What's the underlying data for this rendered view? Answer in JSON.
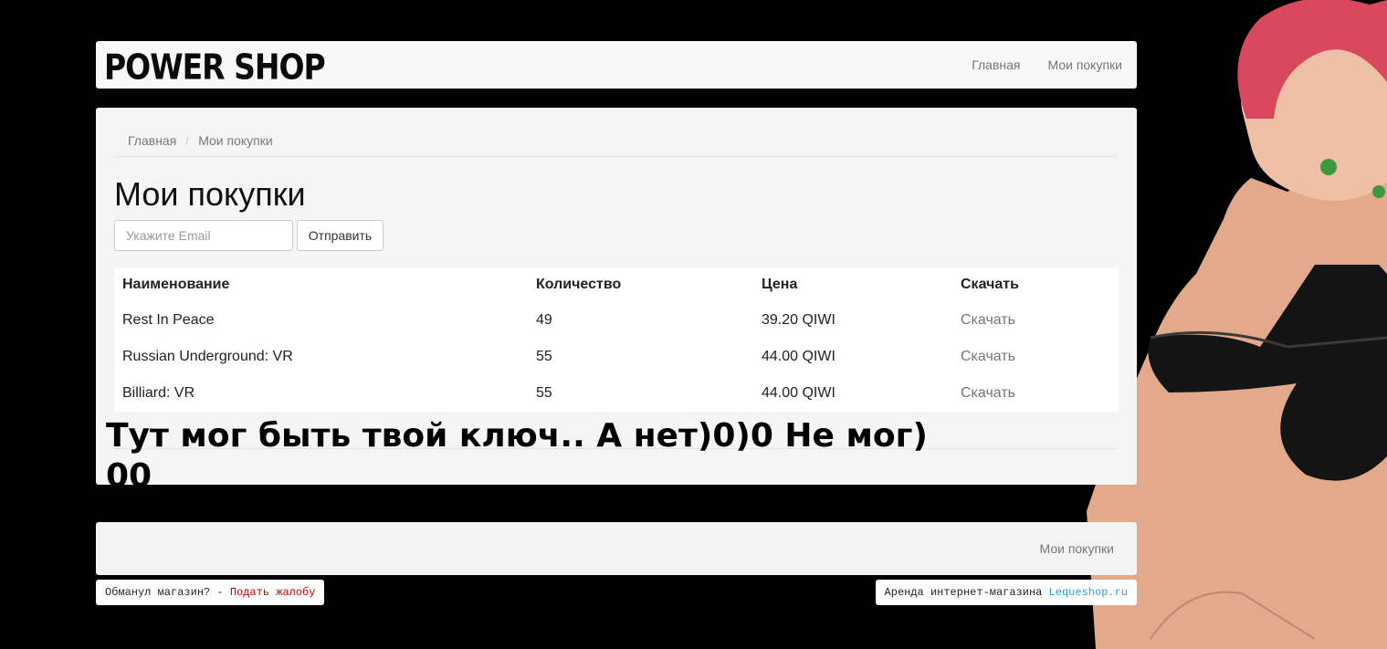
{
  "colors": {
    "page_background": "#000000",
    "complaint_link": "#cc0000",
    "lequeshop_link": "#2aa3d8"
  },
  "navbar": {
    "brand": "POWER SHOP",
    "links": [
      "Главная",
      "Мои покупки"
    ]
  },
  "breadcrumb": {
    "items": [
      "Главная",
      "Мои покупки"
    ],
    "separator": "/"
  },
  "main": {
    "title": "Мои покупки",
    "email_placeholder": "Укажите Email",
    "submit_label": "Отправить",
    "table": {
      "headers": [
        "Наименование",
        "Количество",
        "Цена",
        "Скачать"
      ],
      "rows": [
        {
          "name": "Rest In Peace",
          "qty": "49",
          "price": "39.20 QIWI",
          "action": "Скачать"
        },
        {
          "name": "Russian Underground: VR",
          "qty": "55",
          "price": "44.00 QIWI",
          "action": "Скачать"
        },
        {
          "name": "Billiard: VR",
          "qty": "55",
          "price": "44.00 QIWI",
          "action": "Скачать"
        }
      ]
    },
    "overlay_note": "Тут мог быть твой ключ.. А нет)0)0 Не мог) 00"
  },
  "footer": {
    "link": "Мои покупки",
    "complaint_prefix": "Обманул магазин? - ",
    "complaint_link": "Подать жалобу",
    "rent_prefix": "Аренда интернет-магазина ",
    "rent_link": "Lequeshop.ru"
  },
  "decor": {
    "character_art": "anime-character-illustration"
  }
}
